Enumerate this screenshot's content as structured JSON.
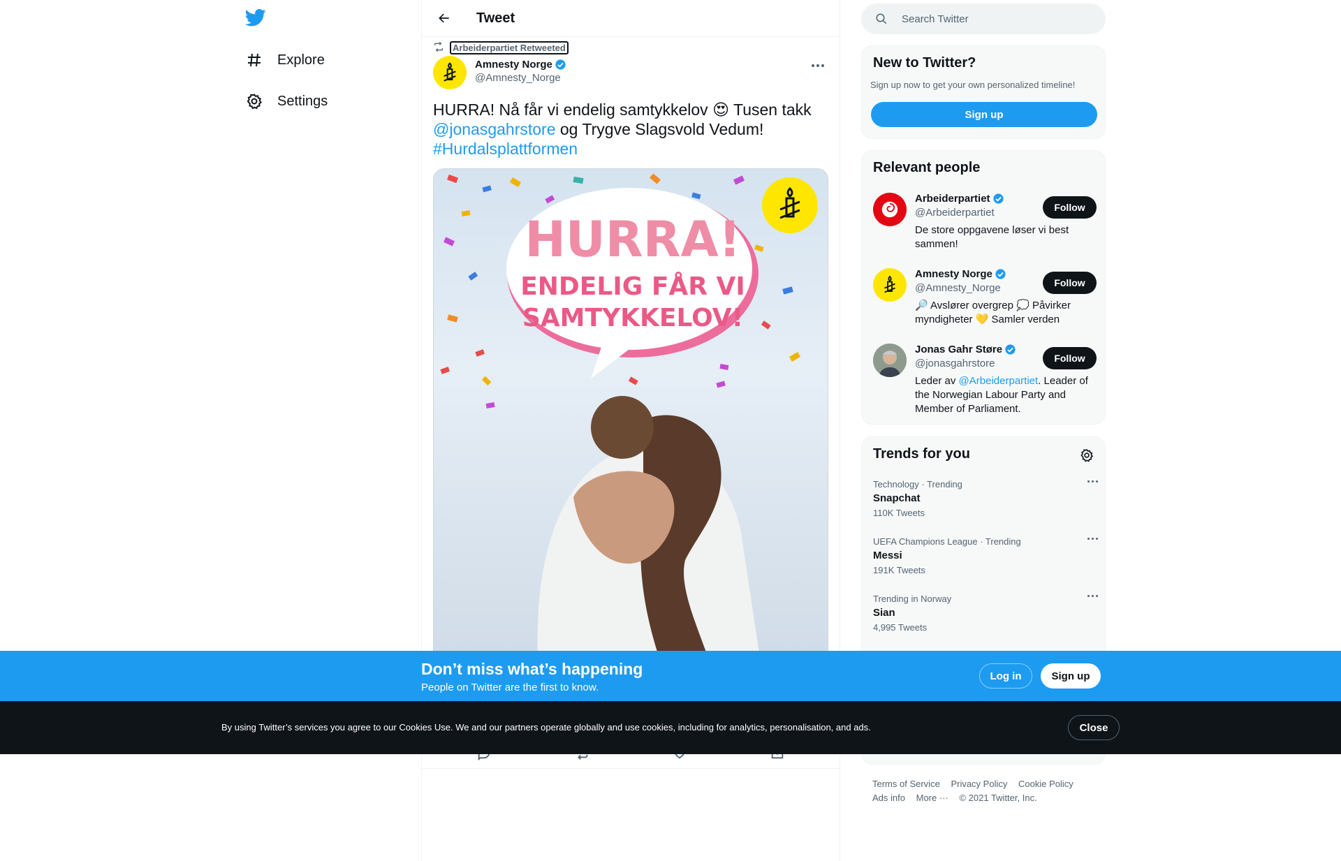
{
  "nav": {
    "explore_label": "Explore",
    "settings_label": "Settings"
  },
  "header": {
    "title": "Tweet"
  },
  "tweet": {
    "retweet_label": "Arbeiderpartiet Retweeted",
    "author_name": "Amnesty Norge",
    "author_handle": "@Amnesty_Norge",
    "text_part1": "HURRA! Nå får vi endelig samtykkelov 😍 Tusen takk",
    "mention": "@jonasgahrstore",
    "text_part2": " og Trygve Slagsvold Vedum!",
    "hashtag": "#Hurdalsplattformen",
    "image_line1": "HURRA!",
    "image_line2": "ENDELIG FÅR VI",
    "image_line3": "SAMTYKKELOV!"
  },
  "search": {
    "placeholder": "Search Twitter"
  },
  "new_to_twitter": {
    "title": "New to Twitter?",
    "subtitle": "Sign up now to get your own personalized timeline!",
    "signup_label": "Sign up"
  },
  "relevant_people": {
    "title": "Relevant people",
    "follow_label": "Follow",
    "people": [
      {
        "name": "Arbeiderpartiet",
        "handle": "@Arbeiderpartiet",
        "bio": "De store oppgavene løser vi best sammen!"
      },
      {
        "name": "Amnesty Norge",
        "handle": "@Amnesty_Norge",
        "bio": "🔎 Avslører overgrep 💭 Påvirker myndigheter 💛 Samler verden"
      },
      {
        "name": "Jonas Gahr Støre",
        "handle": "@jonasgahrstore",
        "bio_pre": "Leder av ",
        "bio_link": "@Arbeiderpartiet",
        "bio_post": ". Leader of the Norwegian Labour Party and Member of Parliament."
      }
    ]
  },
  "trends": {
    "title": "Trends for you",
    "items": [
      {
        "meta": "Technology · Trending",
        "name": "Snapchat",
        "count": "110K Tweets"
      },
      {
        "meta": "UEFA Champions League · Trending",
        "name": "Messi",
        "count": "191K Tweets"
      },
      {
        "meta": "Trending in Norway",
        "name": "Sian",
        "count": "4,995 Tweets"
      }
    ]
  },
  "footer": {
    "terms": "Terms of Service",
    "privacy": "Privacy Policy",
    "cookie": "Cookie Policy",
    "ads": "Ads info",
    "more": "More ···",
    "copyright": "© 2021 Twitter, Inc."
  },
  "login_bar": {
    "heading": "Don’t miss what’s happening",
    "sub": "People on Twitter are the first to know.",
    "login_label": "Log in",
    "signup_label": "Sign up"
  },
  "cookie_bar": {
    "text": "By using Twitter’s services you agree to our Cookies Use. We and our partners operate globally and use cookies, including for analytics, personalisation, and ads.",
    "close_label": "Close"
  },
  "colors": {
    "accent": "#1d9bf0",
    "amnesty_yellow": "#ffe600",
    "dark": "#0f1419"
  }
}
